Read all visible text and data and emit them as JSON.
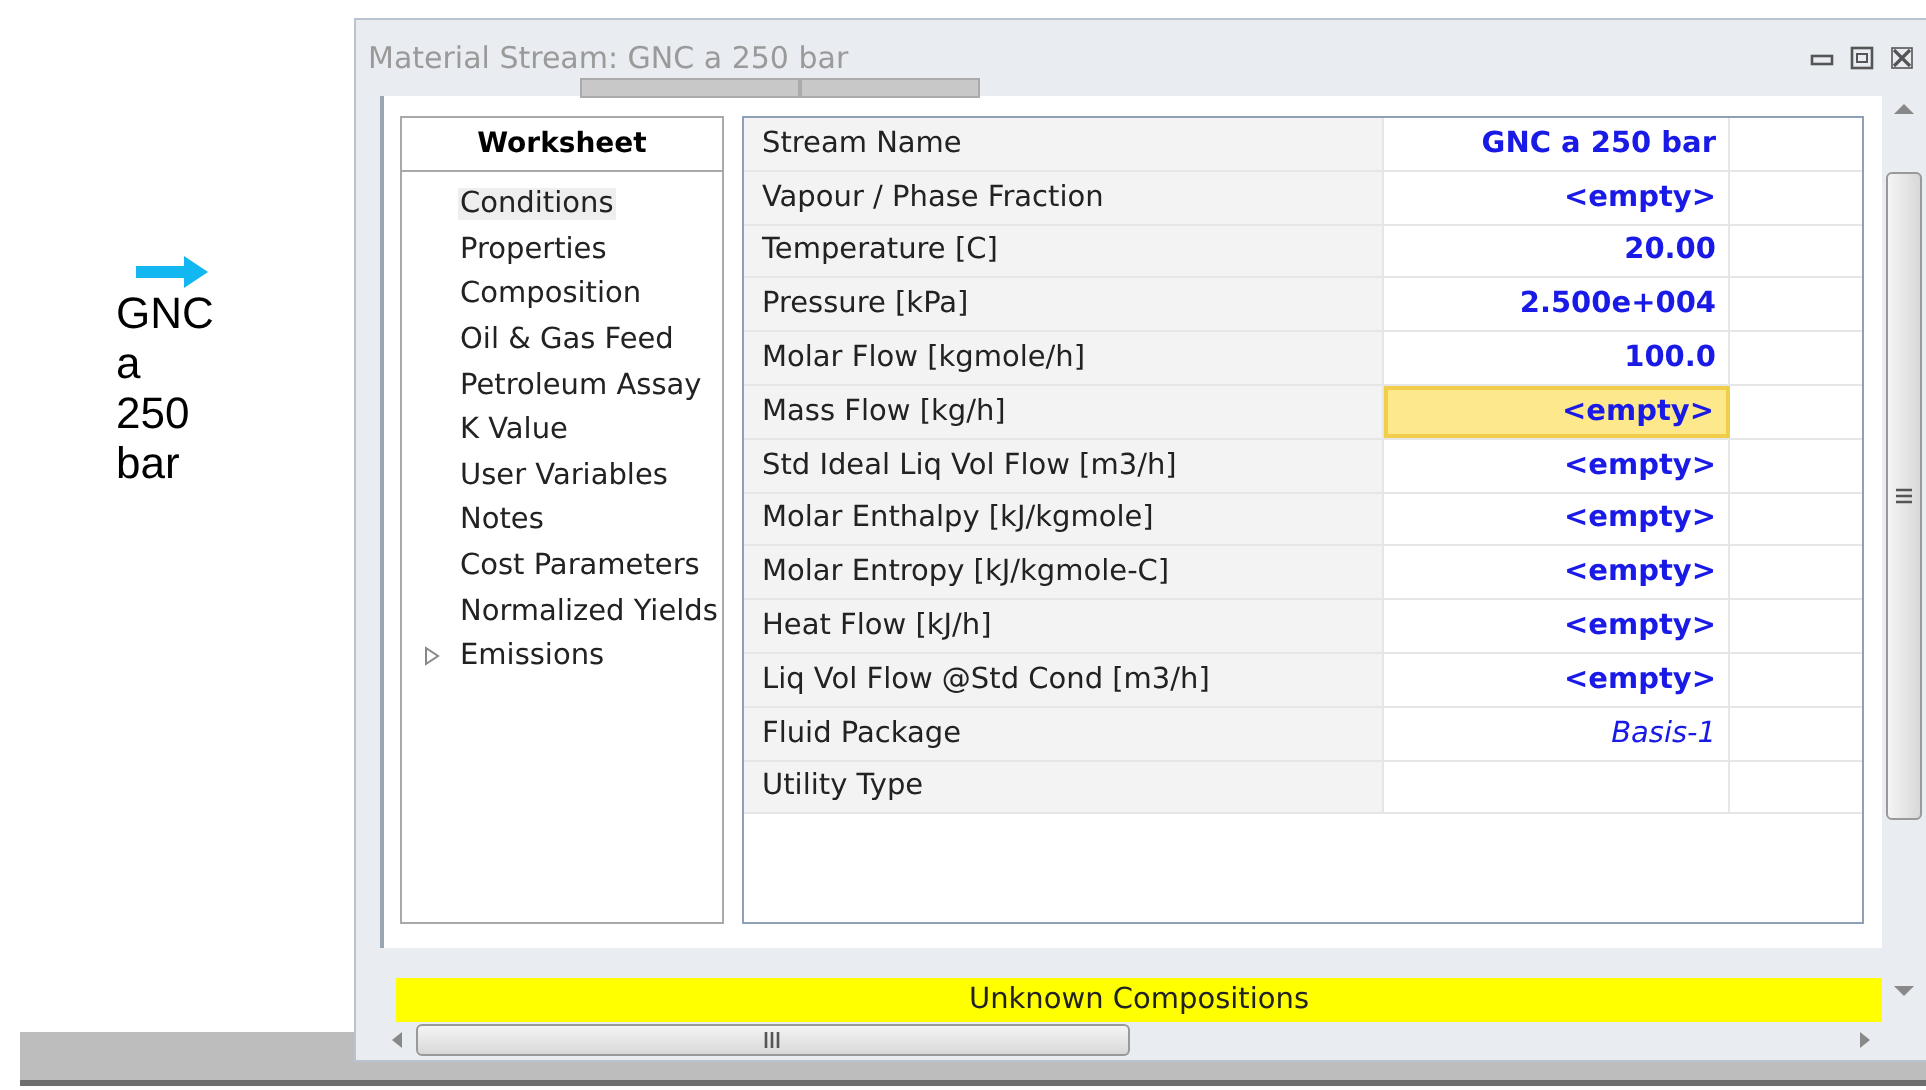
{
  "canvas": {
    "streams": [
      {
        "label": "GNC a 250 bar"
      }
    ]
  },
  "window": {
    "title": "Material Stream: GNC a 250 bar"
  },
  "sidebar": {
    "title": "Worksheet",
    "items": [
      {
        "label": "Conditions",
        "selected": true,
        "kind": "leaf"
      },
      {
        "label": "Properties",
        "selected": false,
        "kind": "leaf"
      },
      {
        "label": "Composition",
        "selected": false,
        "kind": "leaf"
      },
      {
        "label": "Oil & Gas Feed",
        "selected": false,
        "kind": "leaf"
      },
      {
        "label": "Petroleum Assay",
        "selected": false,
        "kind": "leaf"
      },
      {
        "label": "K Value",
        "selected": false,
        "kind": "leaf"
      },
      {
        "label": "User Variables",
        "selected": false,
        "kind": "leaf"
      },
      {
        "label": "Notes",
        "selected": false,
        "kind": "leaf"
      },
      {
        "label": "Cost Parameters",
        "selected": false,
        "kind": "leaf"
      },
      {
        "label": "Normalized Yields",
        "selected": false,
        "kind": "leaf"
      },
      {
        "label": "Emissions",
        "selected": false,
        "kind": "group"
      }
    ]
  },
  "table": {
    "rows": [
      {
        "label": "Stream Name",
        "value": "GNC a 250 bar",
        "kind": "input",
        "selected": false
      },
      {
        "label": "Vapour / Phase Fraction",
        "value": "<empty>",
        "kind": "input",
        "selected": false
      },
      {
        "label": "Temperature [C]",
        "value": "20.00",
        "kind": "input",
        "selected": false
      },
      {
        "label": "Pressure [kPa]",
        "value": "2.500e+004",
        "kind": "input",
        "selected": false
      },
      {
        "label": "Molar Flow [kgmole/h]",
        "value": "100.0",
        "kind": "input",
        "selected": false
      },
      {
        "label": "Mass Flow [kg/h]",
        "value": "<empty>",
        "kind": "input",
        "selected": true
      },
      {
        "label": "Std Ideal Liq Vol Flow [m3/h]",
        "value": "<empty>",
        "kind": "input",
        "selected": false
      },
      {
        "label": "Molar Enthalpy [kJ/kgmole]",
        "value": "<empty>",
        "kind": "input",
        "selected": false
      },
      {
        "label": "Molar Entropy [kJ/kgmole-C]",
        "value": "<empty>",
        "kind": "input",
        "selected": false
      },
      {
        "label": "Heat Flow [kJ/h]",
        "value": "<empty>",
        "kind": "input",
        "selected": false
      },
      {
        "label": "Liq Vol Flow @Std Cond [m3/h]",
        "value": "<empty>",
        "kind": "input",
        "selected": false
      },
      {
        "label": "Fluid Package",
        "value": "Basis-1",
        "kind": "link",
        "selected": false
      },
      {
        "label": "Utility Type",
        "kind": "blank",
        "selected": false
      }
    ]
  },
  "status_bar": {
    "text": "Unknown Compositions"
  }
}
